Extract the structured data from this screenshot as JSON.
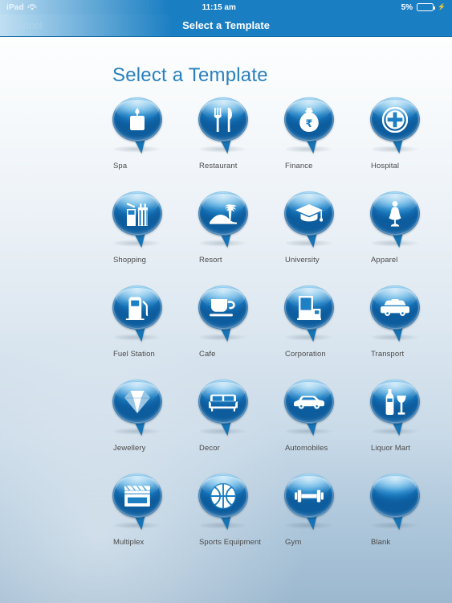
{
  "status_bar": {
    "device": "iPad",
    "wifi_icon": "wifi-icon",
    "time": "11:15 am",
    "battery_percent": "5%",
    "battery_icon": "battery-icon",
    "charging_icon": "lightning-bolt-icon"
  },
  "nav_bar": {
    "cancel_label": "Cancel",
    "title": "Select a Template"
  },
  "page": {
    "title": "Select a Template"
  },
  "colors": {
    "nav_blue": "#1a7ec2",
    "title_blue": "#2980bd",
    "bubble_blue": "#1d7fc4",
    "bubble_dark": "#0d5d9e",
    "label_gray": "#4a4a4a"
  },
  "templates": [
    {
      "label": "Spa",
      "icon": "candle-icon"
    },
    {
      "label": "Restaurant",
      "icon": "fork-knife-icon"
    },
    {
      "label": "Finance",
      "icon": "money-bag-rupee-icon"
    },
    {
      "label": "Hospital",
      "icon": "medical-cross-circle-icon"
    },
    {
      "label": "Shopping",
      "icon": "shopping-bags-icon"
    },
    {
      "label": "Resort",
      "icon": "palm-island-icon"
    },
    {
      "label": "University",
      "icon": "graduation-cap-icon"
    },
    {
      "label": "Apparel",
      "icon": "dress-mannequin-icon"
    },
    {
      "label": "Fuel Station",
      "icon": "fuel-pump-icon"
    },
    {
      "label": "Cafe",
      "icon": "coffee-cup-icon"
    },
    {
      "label": "Corporation",
      "icon": "office-building-icon"
    },
    {
      "label": "Transport",
      "icon": "taxi-car-icon"
    },
    {
      "label": "Jewellery",
      "icon": "diamond-icon"
    },
    {
      "label": "Decor",
      "icon": "sofa-icon"
    },
    {
      "label": "Automobiles",
      "icon": "car-icon"
    },
    {
      "label": "Liquor Mart",
      "icon": "bottle-wineglass-icon"
    },
    {
      "label": "Multiplex",
      "icon": "clapperboard-icon"
    },
    {
      "label": "Sports Equipment",
      "icon": "basketball-icon"
    },
    {
      "label": "Gym",
      "icon": "dumbbell-icon"
    },
    {
      "label": "Blank",
      "icon": "blank-icon"
    }
  ]
}
